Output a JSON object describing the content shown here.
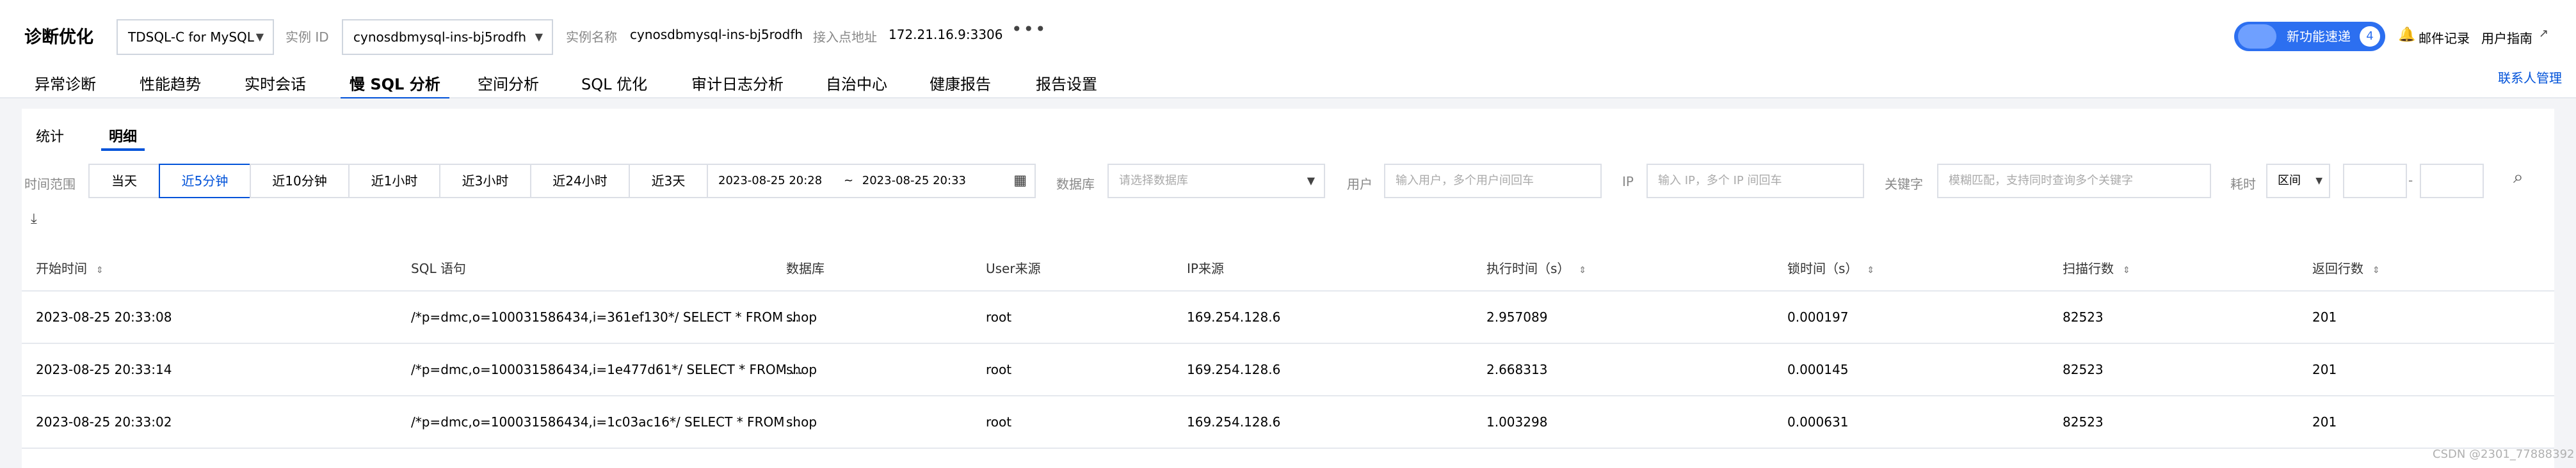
{
  "header": {
    "title": "诊断优化",
    "db_type": "TDSQL-C for MySQL",
    "instance_id_label": "实例 ID",
    "instance_id_value": "cynosdbmysql-ins-bj5rodfh",
    "instance_name_label": "实例名称",
    "instance_name_value": "cynosdbmysql-ins-bj5rodfh",
    "access_label": "接入点地址",
    "access_value": "172.21.16.9:3306",
    "new_feature": "新功能速递",
    "new_feature_count": "4",
    "mail_record": "邮件记录",
    "user_guide": "用户指南",
    "contact_mgmt": "联系人管理"
  },
  "tabs": [
    "异常诊断",
    "性能趋势",
    "实时会话",
    "慢 SQL 分析",
    "空间分析",
    "SQL 优化",
    "审计日志分析",
    "自治中心",
    "健康报告",
    "报告设置"
  ],
  "subtabs": [
    "统计",
    "明细"
  ],
  "filters": {
    "time_range_label": "时间范围",
    "quick_ranges": [
      "当天",
      "近5分钟",
      "近10分钟",
      "近1小时",
      "近3小时",
      "近24小时",
      "近3天"
    ],
    "date_start": "2023-08-25 20:28",
    "date_sep": "~",
    "date_end": "2023-08-25 20:33",
    "db_label": "数据库",
    "db_placeholder": "请选择数据库",
    "user_label": "用户",
    "user_placeholder": "输入用户，多个用户间回车",
    "ip_label": "IP",
    "ip_placeholder": "输入 IP，多个 IP 间回车",
    "kw_label": "关键字",
    "kw_placeholder": "模糊匹配，支持同时查询多个关键字",
    "duration_label": "耗时",
    "duration_mode": "区间",
    "range_dash": "-"
  },
  "table": {
    "columns": [
      "开始时间",
      "SQL 语句",
      "数据库",
      "User来源",
      "IP来源",
      "执行时间（s）",
      "锁时间（s）",
      "扫描行数",
      "返回行数"
    ],
    "rows": [
      [
        "2023-08-25 20:33:08",
        "/*p=dmc,o=100031586434,i=361ef130*/ SELECT * FROM ...",
        "shop",
        "root",
        "169.254.128.6",
        "2.957089",
        "0.000197",
        "82523",
        "201"
      ],
      [
        "2023-08-25 20:33:14",
        "/*p=dmc,o=100031586434,i=1e477d61*/ SELECT * FROM ...",
        "shop",
        "root",
        "169.254.128.6",
        "2.668313",
        "0.000145",
        "82523",
        "201"
      ],
      [
        "2023-08-25 20:33:02",
        "/*p=dmc,o=100031586434,i=1c03ac16*/ SELECT * FROM ...",
        "shop",
        "root",
        "169.254.128.6",
        "1.003298",
        "0.000631",
        "82523",
        "201"
      ]
    ]
  },
  "watermark": "CSDN @2301_77888392",
  "icons": {
    "more": "more-icon",
    "bell": "bell-icon",
    "external": "external-link-icon",
    "calendar": "calendar-icon",
    "search": "search-icon",
    "download": "download-icon"
  },
  "colors": {
    "accent": "#0052d9",
    "new_feature_bg": "#2c6ff0"
  }
}
